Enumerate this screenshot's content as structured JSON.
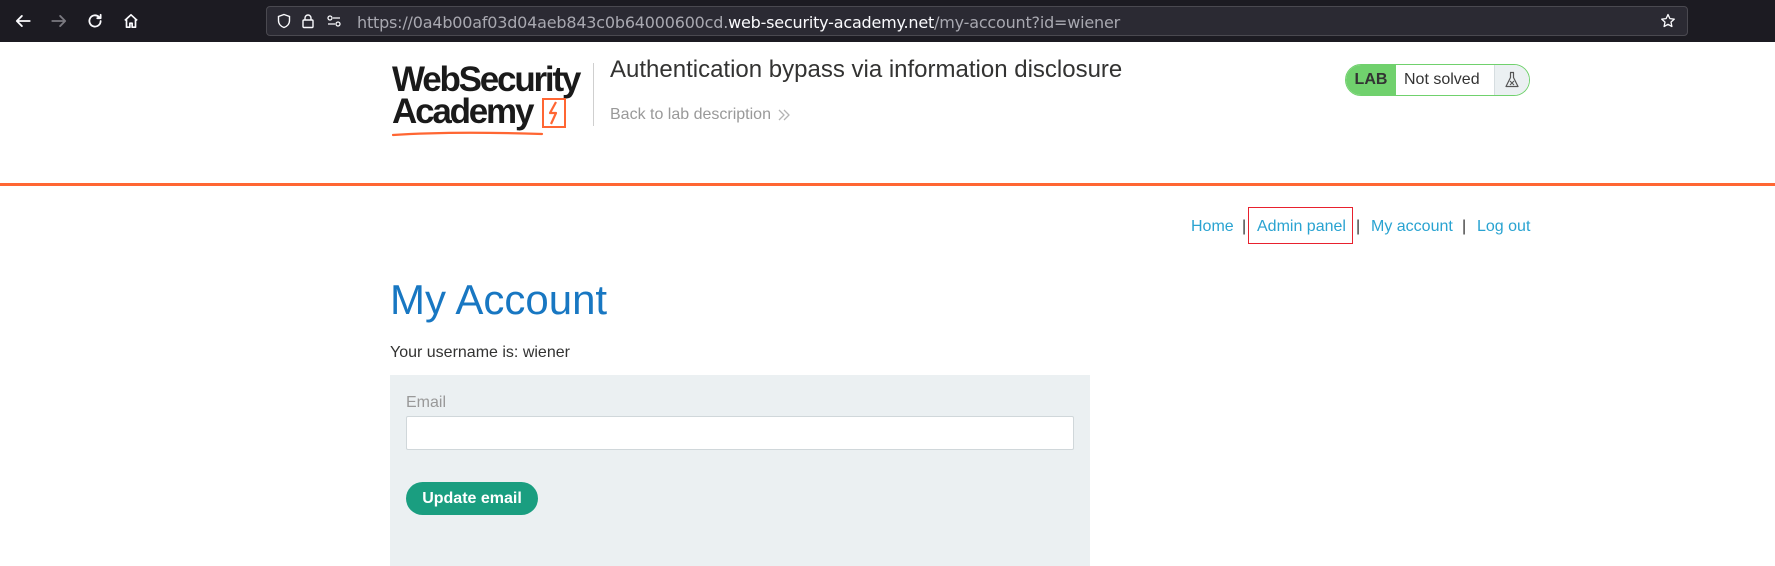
{
  "browser": {
    "url_prefix": "https://0a4b00af03d04aeb843c0b64000600cd.",
    "url_domain": "web-security-academy.net",
    "url_path": "/my-account?id=wiener"
  },
  "header": {
    "logo_line1": "WebSecurity",
    "logo_line2": "Academy",
    "lab_title": "Authentication bypass via information disclosure",
    "back_link": "Back to lab description",
    "lab_tag": "LAB",
    "lab_status": "Not solved"
  },
  "nav": {
    "home": "Home",
    "admin_panel": "Admin panel",
    "my_account": "My account",
    "log_out": "Log out",
    "separator": "|"
  },
  "main": {
    "title": "My Account",
    "username_line": "Your username is: wiener",
    "email_label": "Email",
    "email_value": "",
    "update_button": "Update email"
  },
  "colors": {
    "accent_orange": "#ff6633",
    "link_blue": "#29a3d1",
    "title_blue": "#1877c2",
    "button_green": "#1a9e80",
    "lab_green": "#70d16d",
    "highlight_red": "#e8212e"
  }
}
